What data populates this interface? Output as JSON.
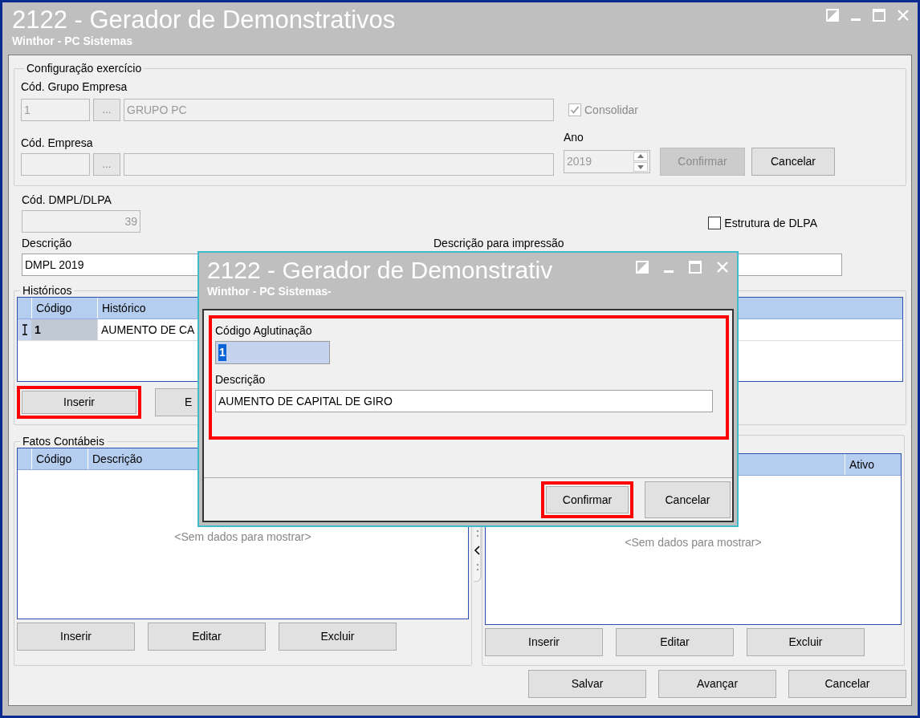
{
  "window": {
    "title": "2122 - Gerador de Demonstrativos",
    "subtitle": "Winthor - PC Sistemas"
  },
  "config": {
    "legend": "Configuração exercício",
    "grupo_label": "Cód. Grupo Empresa",
    "grupo_code": "1",
    "grupo_name": "GRUPO PC",
    "lookup_buttons": [
      "...",
      "..."
    ],
    "consolidar": {
      "label": "Consolidar",
      "checked": true,
      "disabled": true
    },
    "empresa_label": "Cód. Empresa",
    "ano_label": "Ano",
    "ano": "2019",
    "buttons": [
      {
        "label": "Confirmar",
        "disabled": true
      },
      {
        "label": "Cancelar",
        "disabled": false
      }
    ]
  },
  "dmpl": {
    "label": "Cód. DMPL/DLPA",
    "value": "39"
  },
  "estrutura": {
    "label": "Estrutura de DLPA",
    "checked": false
  },
  "descricao": {
    "label": "Descrição",
    "value": "DMPL 2019"
  },
  "descricao_impressao": {
    "label": "Descrição para impressão"
  },
  "historicos": {
    "legend": "Históricos",
    "columns": [
      "Código",
      "Histórico"
    ],
    "rows": [
      {
        "codigo": "1",
        "historico": "AUMENTO DE CA",
        "selected": true
      }
    ],
    "buttons": [
      {
        "label": "Inserir",
        "highlighted": true
      },
      {
        "label": "E",
        "highlighted": false
      }
    ]
  },
  "fatos": {
    "legend": "Fatos Contábeis",
    "columns": [
      "Código",
      "Descrição"
    ],
    "empty_text": "<Sem dados para mostrar>",
    "buttons": [
      {
        "label": "Inserir",
        "highlighted": false
      },
      {
        "label": "Editar",
        "highlighted": false
      },
      {
        "label": "Excluir",
        "highlighted": false
      }
    ]
  },
  "right_grid": {
    "columns": [
      "Ativo"
    ],
    "empty_text": "<Sem dados para mostrar>",
    "buttons": [
      {
        "label": "Inserir",
        "highlighted": false
      },
      {
        "label": "Editar",
        "highlighted": false
      },
      {
        "label": "Excluir",
        "highlighted": false
      }
    ]
  },
  "footer_buttons": [
    {
      "label": "Salvar"
    },
    {
      "label": "Avançar"
    },
    {
      "label": "Cancelar"
    }
  ],
  "dialog": {
    "title": "2122 - Gerador de Demonstrativ",
    "subtitle": "Winthor - PC Sistemas-",
    "form_highlighted": true,
    "codigo_label": "Código Aglutinação",
    "codigo_value": "1",
    "descricao_label": "Descrição",
    "descricao_value": "AUMENTO DE CAPITAL DE GIRO",
    "buttons": [
      {
        "label": "Confirmar",
        "highlighted": true
      },
      {
        "label": "Cancelar",
        "highlighted": false
      }
    ]
  }
}
